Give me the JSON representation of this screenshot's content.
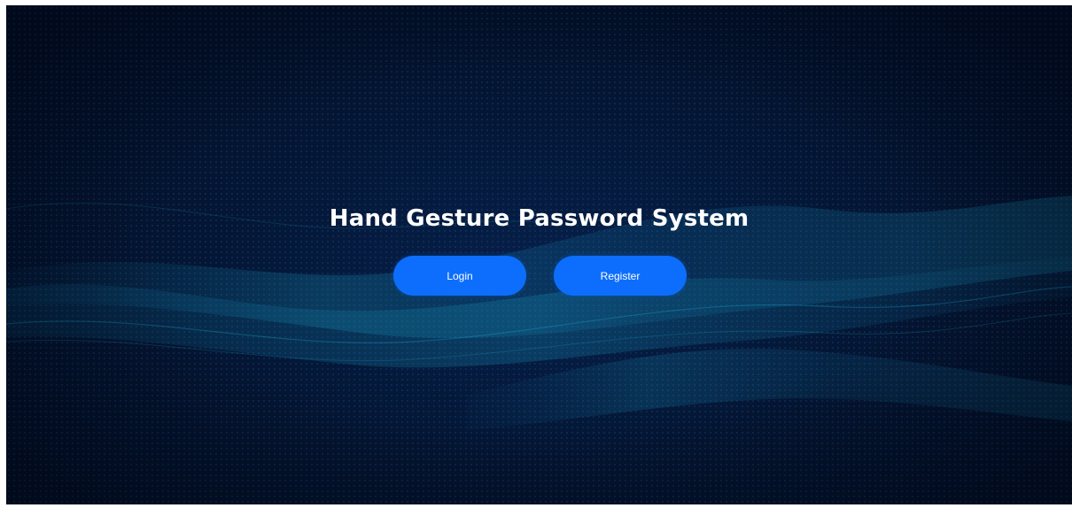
{
  "page": {
    "title": "Hand Gesture Password System"
  },
  "actions": {
    "login_label": "Login",
    "register_label": "Register"
  },
  "colors": {
    "background": "#020c24",
    "wave_glow": "#1aa3c8",
    "button": "#0d6efd",
    "text": "#ffffff"
  }
}
